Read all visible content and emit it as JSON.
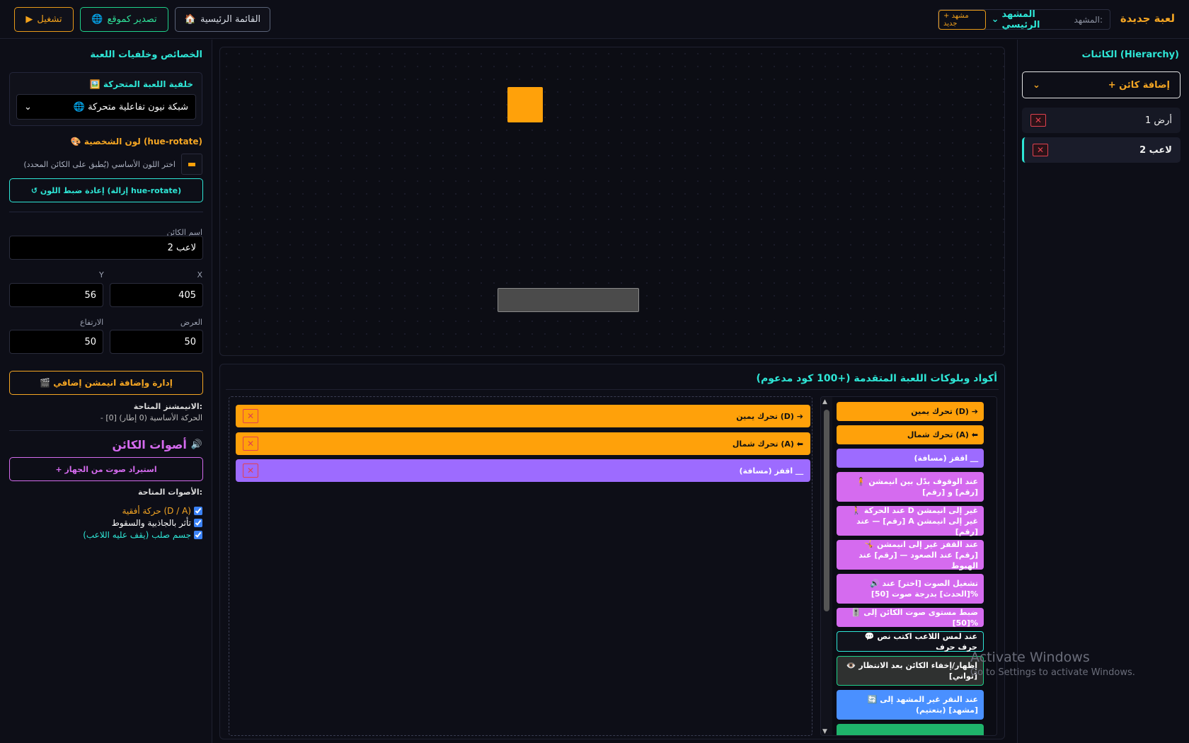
{
  "toolbar": {
    "run_label": "تشغيل",
    "run_icon": "▶",
    "export_label": "تصدير كموقع",
    "export_icon": "🌐",
    "home_label": "القائمة الرئيسية",
    "home_icon": "🏠"
  },
  "app": {
    "title": "لعبة جديدة"
  },
  "scene": {
    "label": "المشهد:",
    "current": "المشهد الرئيسي",
    "new_scene": "+ مشهد جديد"
  },
  "hierarchy": {
    "title": "الكائنات (Hierarchy)",
    "add_object": "+ إضافة كائن",
    "items": [
      {
        "label": "أرض 1"
      },
      {
        "label": "لاعب 2"
      }
    ]
  },
  "properties": {
    "title": "الخصائص وخلفيات اللعبة",
    "bg_card_title": "🖼️ خلفية اللعبة المتحركة",
    "bg_value": "🌐 شبكة نيون تفاعلية متحركة",
    "color_title": "🎨 لون الشخصية (hue-rotate)",
    "color_hint": "اختر اللون الأساسي (يُطبق على الكائن المحدد)",
    "reset_color": "↺ إعادة ضبط اللون (إزالة hue-rotate)",
    "name_label": "اسم الكائن",
    "name_value": "لاعب 2",
    "x_label": "X",
    "x_value": "405",
    "y_label": "Y",
    "y_value": "56",
    "width_label": "العرض",
    "width_value": "50",
    "height_label": "الارتفاع",
    "height_value": "50",
    "anim_button": "🎬 إدارة وإضافة انيمشن إضافي",
    "anim_title": "الانيمشنز المتاحة:",
    "anim_item": "- [0] الحركة الأساسية (0 إطار)",
    "sounds_title": "أصوات الكائن",
    "import_sound": "+ استيراد صوت من الجهاز",
    "avail_sounds": "الأصوات المتاحة:",
    "checks": [
      {
        "label": "حركة أفقية (D / A)",
        "color": "#f5a623"
      },
      {
        "label": "تأثر بالجاذبية والسقوط",
        "color": "#ffffff"
      },
      {
        "label": "جسم صلب (يقف عليه اللاعب)",
        "color": "#2ee6d6"
      }
    ]
  },
  "blocks": {
    "title": "أكواد وبلوكات اللعبة المتقدمة (+100 كود مدعوم)",
    "workspace": [
      {
        "label": "تحرك يمين (D) ➔"
      },
      {
        "label": "تحرك شمال (A) ⬅"
      },
      {
        "label": "اقفز (مسافة) ⸏"
      }
    ],
    "palette": [
      {
        "label": "تحرك يمين (D) ➔"
      },
      {
        "label": "تحرك شمال (A) ⬅"
      },
      {
        "label": "اقفز (مسافة) ⸏"
      },
      {
        "label": "🧍 عند الوقوف بدّل بين انيمشن [رقم] و [رقم]"
      },
      {
        "label": "🚶 عند الحركة D غير إلى انيمشن [رقم] — عند A غير إلى انيمشن [رقم]"
      },
      {
        "label": "🤸 عند القفز غير إلى انيمشن [رقم] عند الصعود — [رقم] عند الهبوط"
      },
      {
        "label": "🔊 تشغيل الصوت [اختر] عند [الحدث] بدرجة صوت [50]%"
      },
      {
        "label": "🎚️ ضبط مستوى صوت الكائن إلى [50]%"
      },
      {
        "label": "💬 عند لمس اللاعب اكتب نص حرف حرف"
      },
      {
        "label": "👁️ إظهار/إخفاء الكائن بعد الانتظار [ثواني]"
      },
      {
        "label": "🔄 عند النقر غير المشهد إلى [مشهد] (بتعتيم)"
      },
      {
        "label": ""
      }
    ]
  },
  "watermark": {
    "line1": "Activate Windows",
    "line2": "Go to Settings to activate Windows."
  }
}
